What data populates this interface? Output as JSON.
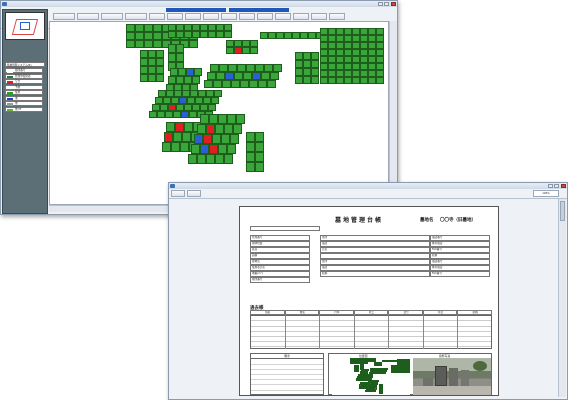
{
  "main_window": {
    "title": ""
  },
  "legend": {
    "header": "墓地管理システム(R)",
    "items": [
      {
        "label": "墓所番号",
        "color": "#ffffff"
      },
      {
        "label": "管理中使用者",
        "color": "#1c7d3c"
      },
      {
        "label": "空き",
        "color": "#e02020"
      },
      {
        "label": "予約",
        "color": "#ffffff"
      },
      {
        "label": "使用",
        "color": "#2d9b2d"
      },
      {
        "label": "未",
        "color": "#2244cc"
      },
      {
        "label": "他",
        "color": "#999999"
      },
      {
        "label": "他 PT",
        "color": "#6ab23a"
      }
    ]
  },
  "doc_window": {
    "title": "",
    "zoom": "100%"
  },
  "document": {
    "title": "墓地管理台帳",
    "cemetery_label": "墓地名",
    "cemetery_name": "〇〇寺（旧墓地）",
    "history_title": "過去帳",
    "notes_label": "備考",
    "map_label": "位置図",
    "photo_label": "墓所写真",
    "fields_left": [
      "管理番号",
      "墓碑位置",
      "区画",
      "面積",
      "墓地名",
      "使用者氏名",
      "地番(m²)",
      "墓所番号"
    ],
    "fields_right": [
      "住所",
      "電話",
      "氏名",
      "",
      "住所",
      "電話",
      "続柄"
    ],
    "fields_far": [
      "電話番号",
      "携帯電話",
      "FAX番号",
      "続柄",
      "電話番号",
      "携帯電話",
      "FAX番号"
    ],
    "history_headers": [
      "俗名",
      "戒名",
      "行年",
      "死亡",
      "法号",
      "命日",
      "続柄"
    ]
  },
  "colors": {
    "green": "#3aa63a",
    "red": "#e02020",
    "blue": "#2a5fd6"
  }
}
